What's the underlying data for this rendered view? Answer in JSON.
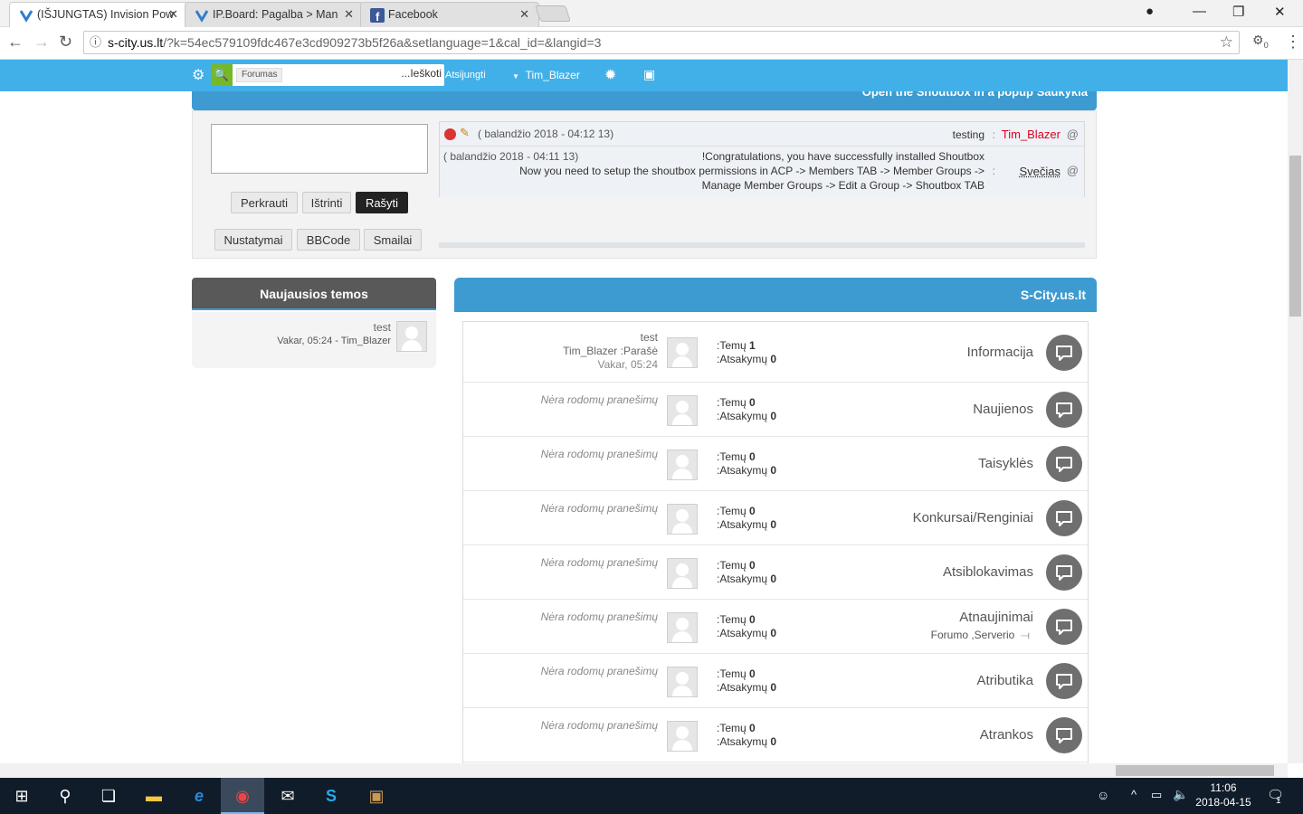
{
  "browser": {
    "tabs": [
      {
        "title": "(IŠJUNGTAS) Invision Pow",
        "active": true
      },
      {
        "title": "IP.Board: Pagalba > Man",
        "active": false
      },
      {
        "title": "Facebook",
        "active": false
      }
    ],
    "url_host": "s-city.us.lt",
    "url_rest": "/?k=54ec579109fdc467e3cd909273b5f26a&setlanguage=1&cal_id=&langid=3",
    "ext_badge": "0"
  },
  "sitebar": {
    "search_scope": "Forumas",
    "search_button": "...Ieškoti",
    "logout": "Atsijungti",
    "username": "Tim_Blazer"
  },
  "shoutbox": {
    "header": "Open the Shoutbox in a popup  Šaukykla",
    "buttons": {
      "reload": "Perkrauti",
      "delete": "Ištrinti",
      "write": "Rašyti",
      "settings": "Nustatymai",
      "bbcode": "BBCode",
      "smilies": "Smailai"
    },
    "shouts": [
      {
        "time": "( balandžio 2018 - 04:12 13)",
        "message": "testing",
        "author": "Tim_Blazer",
        "sep": ":",
        "at": "@"
      },
      {
        "time": "( balandžio 2018 - 04:11 13)",
        "message_line1": "!Congratulations, you have successfully installed Shoutbox",
        "message_line2": "Now you need to setup the shoutbox permissions in ACP -> Members TAB -> Member Groups ->",
        "message_line3": "Manage Member Groups -> Edit a Group -> Shoutbox TAB",
        "author": "Svečias",
        "sep": ":",
        "at": "@"
      }
    ]
  },
  "latest": {
    "title": "Naujausios temos",
    "topic": "test",
    "meta": "Vakar, 05:24 - Tim_Blazer"
  },
  "forum": {
    "title": "S-City.us.lt",
    "topics_label": ":Temų",
    "replies_label": ":Atsakymų",
    "no_posts": "Nėra rodomų pranešimų",
    "rows": [
      {
        "name": "Informacija",
        "topics": "1",
        "replies": "0",
        "last_title": "test",
        "last_author": "Tim_Blazer :Parašė",
        "last_time": "Vakar, 05:24"
      },
      {
        "name": "Naujienos",
        "topics": "0",
        "replies": "0"
      },
      {
        "name": "Taisyklės",
        "topics": "0",
        "replies": "0"
      },
      {
        "name": "Konkursai/Renginiai",
        "topics": "0",
        "replies": "0"
      },
      {
        "name": "Atsiblokavimas",
        "topics": "0",
        "replies": "0"
      },
      {
        "name": "Atnaujinimai",
        "topics": "0",
        "replies": "0",
        "subforums": "Forumo  ,Serverio"
      },
      {
        "name": "Atributika",
        "topics": "0",
        "replies": "0"
      },
      {
        "name": "Atrankos",
        "topics": "0",
        "replies": "0"
      }
    ]
  },
  "taskbar": {
    "time": "11:06",
    "date": "2018-04-15",
    "notif_count": "1"
  }
}
